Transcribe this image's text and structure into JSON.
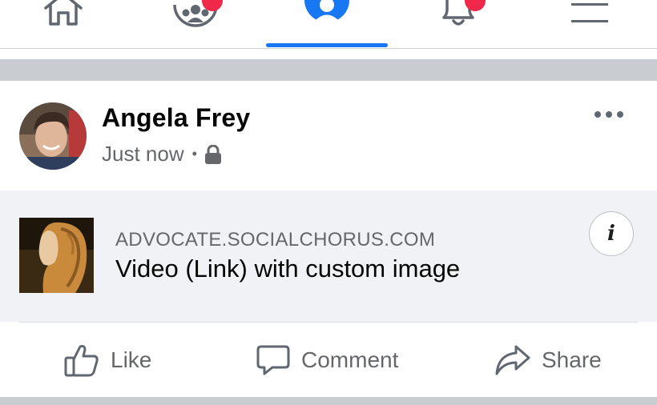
{
  "nav": {
    "items": [
      {
        "name": "home",
        "icon": "home-icon"
      },
      {
        "name": "groups",
        "icon": "groups-icon",
        "has_badge": true
      },
      {
        "name": "profile",
        "icon": "profile-icon",
        "active": true
      },
      {
        "name": "notifications",
        "icon": "bell-icon",
        "has_badge": true
      },
      {
        "name": "menu",
        "icon": "hamburger-menu-icon"
      }
    ],
    "active_color": "#1877f2",
    "badge_color": "#f02849"
  },
  "post": {
    "author": "Angela Frey",
    "timestamp": "Just now",
    "separator": "•",
    "privacy_icon": "lock-icon",
    "link": {
      "domain": "ADVOCATE.SOCIALCHORUS.COM",
      "title": "Video (Link) with custom image",
      "info_label": "i"
    },
    "actions": {
      "like": "Like",
      "comment": "Comment",
      "share": "Share"
    }
  }
}
